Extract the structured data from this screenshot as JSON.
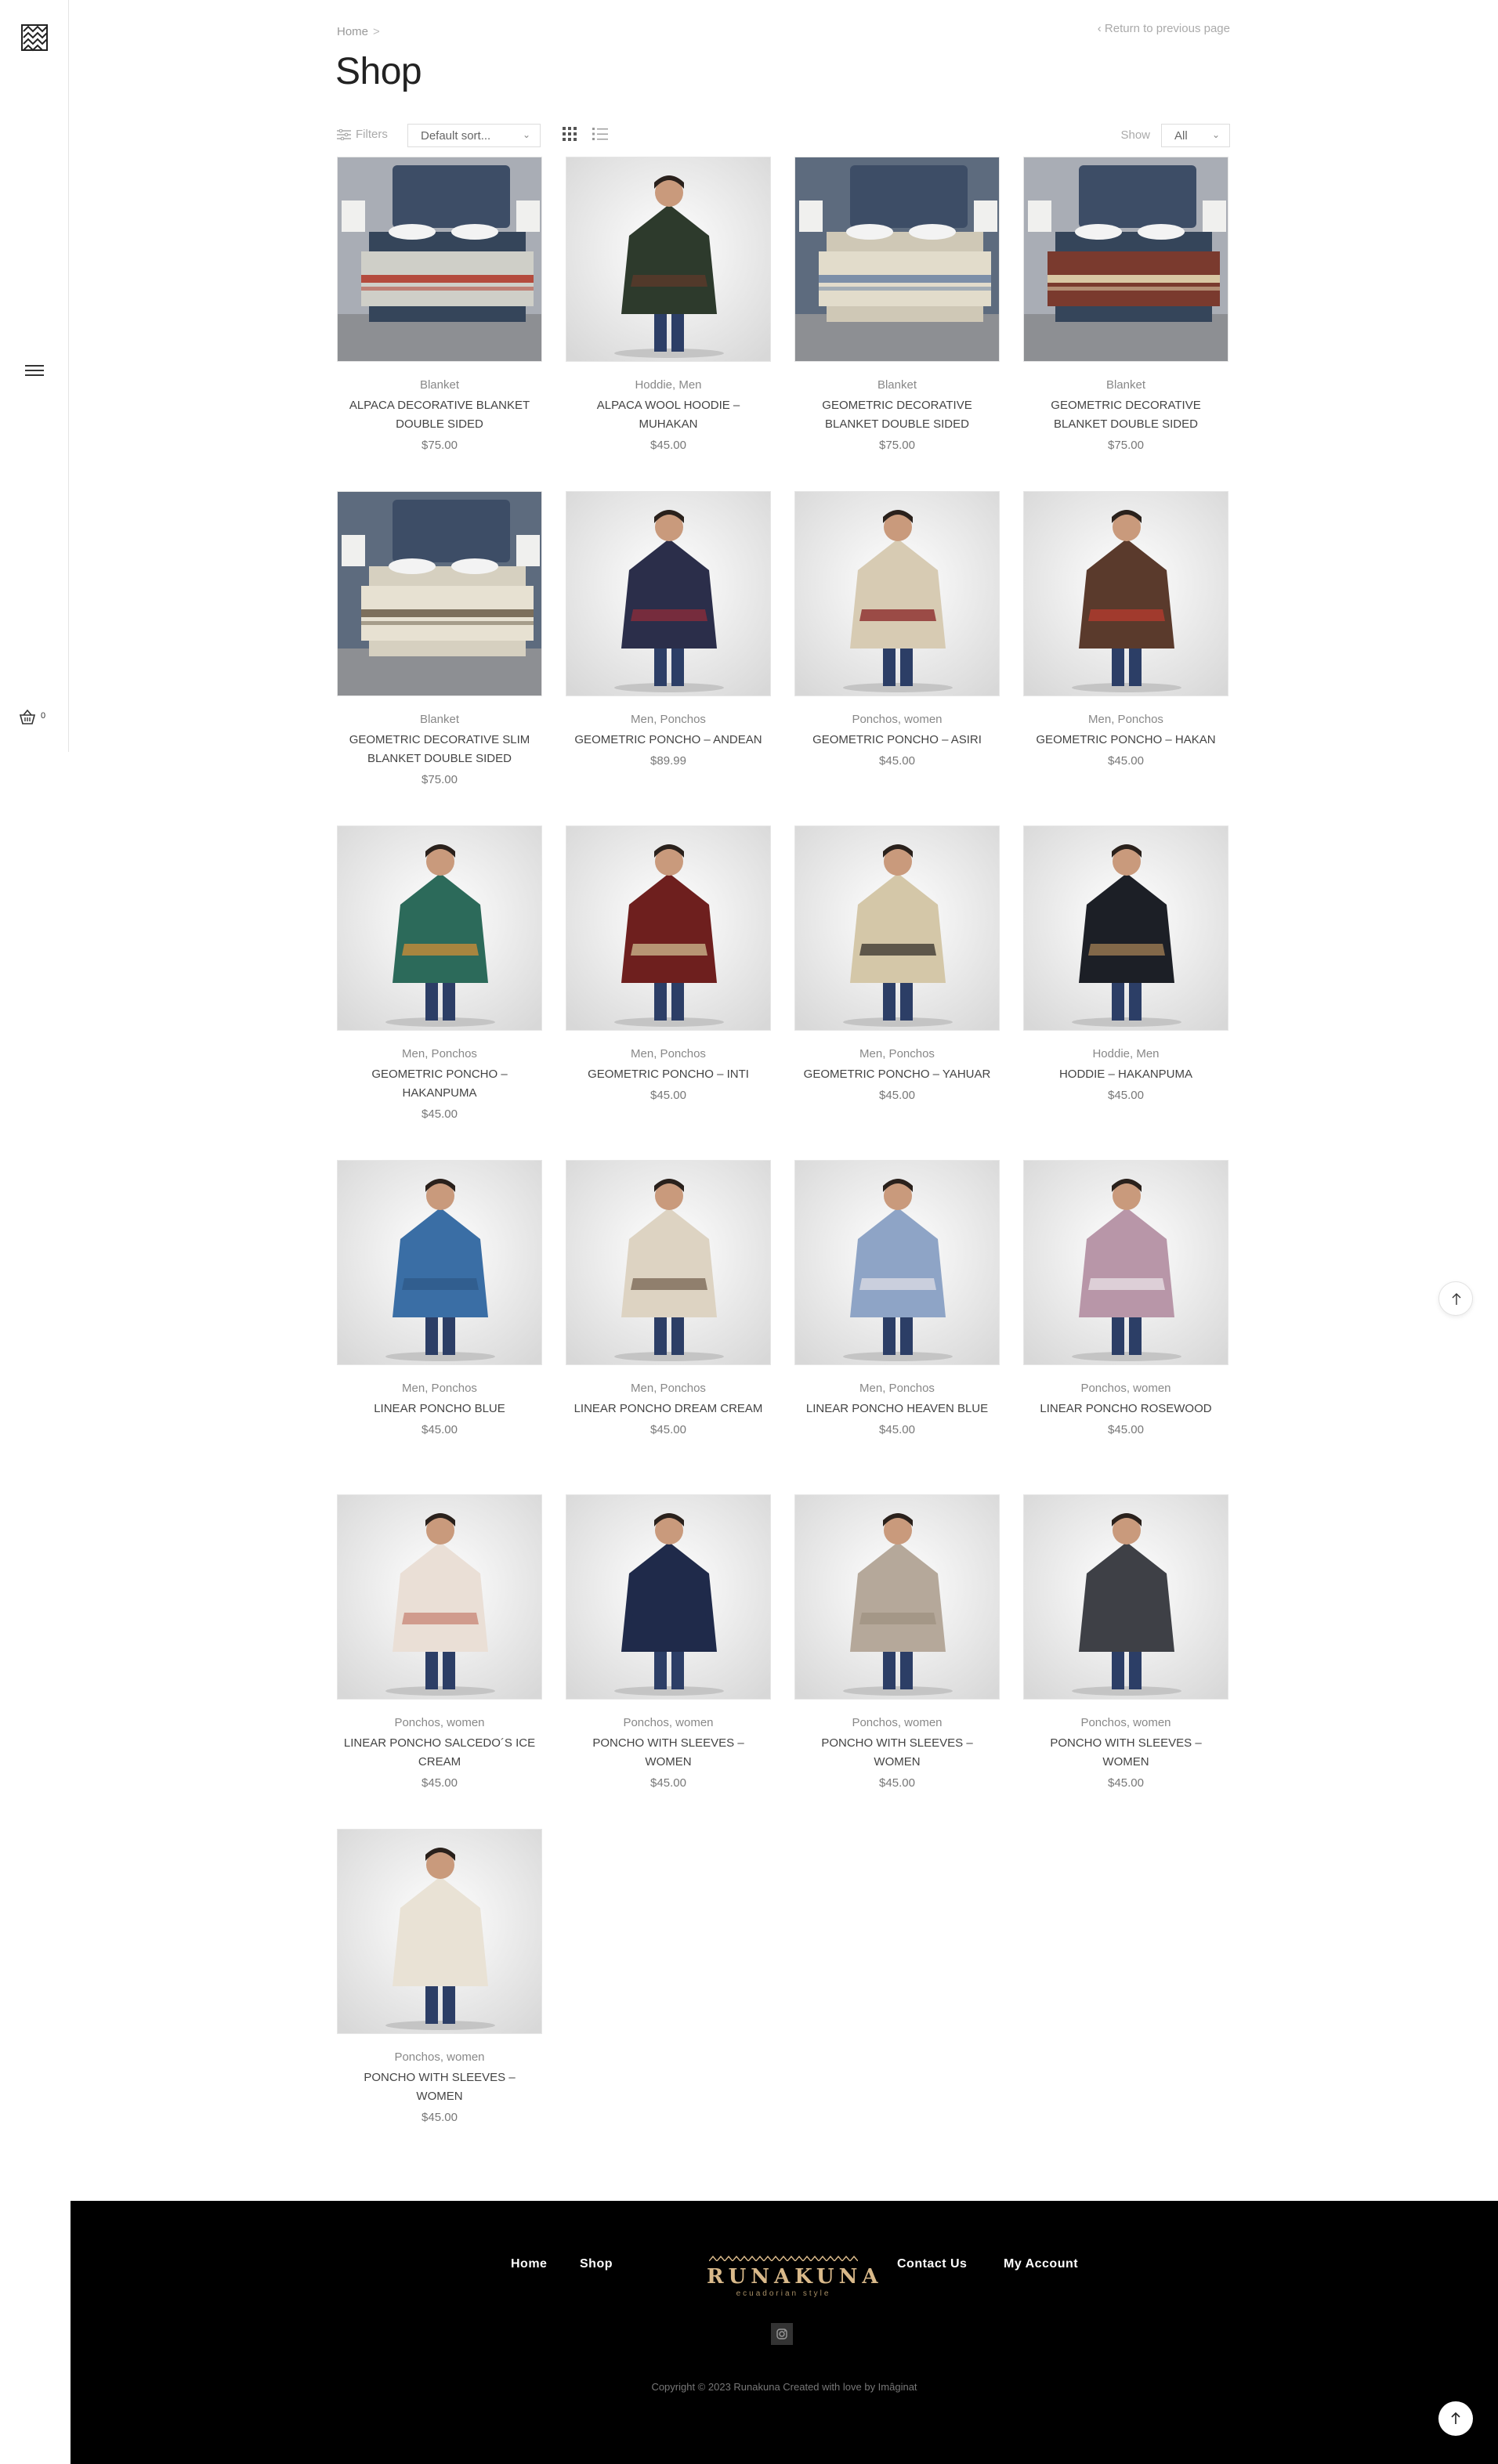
{
  "breadcrumb": {
    "home": "Home",
    "sep": ">"
  },
  "return_link": "Return to previous page",
  "page_title": "Shop",
  "toolbar": {
    "filters_label": "Filters",
    "sort_value": "Default sort...",
    "show_label": "Show",
    "show_value": "All"
  },
  "cart": {
    "count": "0"
  },
  "products": [
    {
      "category": "Blanket",
      "name": "ALPACA DECORATIVE BLANKET DOUBLE SIDED",
      "price": "$75.00",
      "thumb": "blanket-bedroom-light"
    },
    {
      "category": "Hoddie, Men",
      "name": "ALPACA WOOL HOODIE – MUHAKAN",
      "price": "$45.00",
      "thumb": "man-hoodie-green"
    },
    {
      "category": "Blanket",
      "name": "GEOMETRIC DECORATIVE BLANKET DOUBLE SIDED",
      "price": "$75.00",
      "thumb": "blanket-bedroom-cream"
    },
    {
      "category": "Blanket",
      "name": "GEOMETRIC DECORATIVE BLANKET DOUBLE SIDED",
      "price": "$75.00",
      "thumb": "blanket-bedroom-red"
    },
    {
      "category": "Blanket",
      "name": "GEOMETRIC DECORATIVE SLIM BLANKET DOUBLE SIDED",
      "price": "$75.00",
      "thumb": "blanket-bedroom-slim"
    },
    {
      "category": "Men, Ponchos",
      "name": "GEOMETRIC PONCHO – ANDEAN",
      "price": "$89.99",
      "thumb": "man-poncho-navy"
    },
    {
      "category": "Ponchos, women",
      "name": "GEOMETRIC PONCHO – ASIRI",
      "price": "$45.00",
      "thumb": "woman-poncho-beige"
    },
    {
      "category": "Men, Ponchos",
      "name": "GEOMETRIC PONCHO – HAKAN",
      "price": "$45.00",
      "thumb": "man-poncho-brown"
    },
    {
      "category": "Men, Ponchos",
      "name": "GEOMETRIC PONCHO – HAKANPUMA",
      "price": "$45.00",
      "thumb": "man-poncho-multicolor"
    },
    {
      "category": "Men, Ponchos",
      "name": "GEOMETRIC PONCHO – INTI",
      "price": "$45.00",
      "thumb": "man-poncho-red"
    },
    {
      "category": "Men, Ponchos",
      "name": "GEOMETRIC PONCHO – YAHUAR",
      "price": "$45.00",
      "thumb": "man-poncho-cream"
    },
    {
      "category": "Hoddie, Men",
      "name": "HODDIE – HAKANPUMA",
      "price": "$45.00",
      "thumb": "man-hoodie-black"
    },
    {
      "category": "Men, Ponchos",
      "name": "LINEAR PONCHO BLUE",
      "price": "$45.00",
      "thumb": "man-poncho-blue"
    },
    {
      "category": "Men, Ponchos",
      "name": "LINEAR PONCHO DREAM CREAM",
      "price": "$45.00",
      "thumb": "man-poncho-dreamcream"
    },
    {
      "category": "Men, Ponchos",
      "name": "LINEAR PONCHO HEAVEN BLUE",
      "price": "$45.00",
      "thumb": "man-poncho-heavenblue"
    },
    {
      "category": "Ponchos, women",
      "name": "LINEAR PONCHO ROSEWOOD",
      "price": "$45.00",
      "thumb": "woman-poncho-rosewood"
    },
    {
      "category": "Ponchos, women",
      "name": "LINEAR PONCHO SALCEDO´S ICE CREAM",
      "price": "$45.00",
      "thumb": "woman-poncho-icecream"
    },
    {
      "category": "Ponchos, women",
      "name": "PONCHO WITH SLEEVES – WOMEN",
      "price": "$45.00",
      "thumb": "woman-sleeves-navy"
    },
    {
      "category": "Ponchos, women",
      "name": "PONCHO WITH SLEEVES – WOMEN",
      "price": "$45.00",
      "thumb": "woman-sleeves-taupe"
    },
    {
      "category": "Ponchos, women",
      "name": "PONCHO WITH SLEEVES – WOMEN",
      "price": "$45.00",
      "thumb": "woman-sleeves-charcoal"
    },
    {
      "category": "Ponchos, women",
      "name": "PONCHO WITH SLEEVES – WOMEN",
      "price": "$45.00",
      "thumb": "woman-sleeves-ivory"
    }
  ],
  "footer": {
    "nav_home": "Home",
    "nav_shop": "Shop",
    "nav_contact": "Contact Us",
    "nav_account": "My Account",
    "brand_name": "RUNAKUNA",
    "brand_tagline": "ecuadorian style",
    "copyright": "Copyright © 2023 Runakuna Created with love by Imâginat"
  },
  "colors": {
    "accent_gold": "#d9b98a",
    "footer_bg": "#000000",
    "border": "#e6e6e6"
  },
  "icons": [
    "logo-icon",
    "menu-icon",
    "cart-icon",
    "filter-icon",
    "grid-view-icon",
    "list-view-icon",
    "chevron-down-icon",
    "arrow-up-icon",
    "instagram-icon"
  ]
}
